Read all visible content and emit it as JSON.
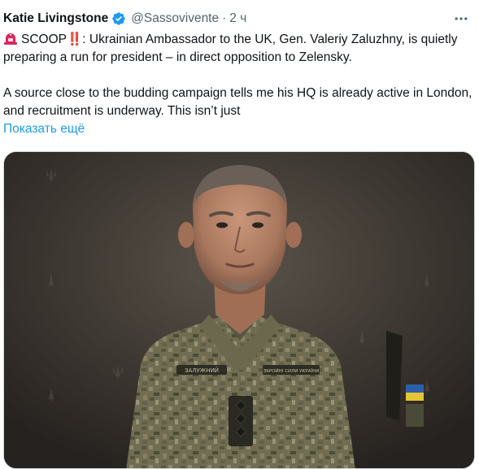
{
  "author": {
    "name": "Katie Livingstone",
    "handle": "@Sassovivente",
    "separator": "·",
    "time": "2 ч"
  },
  "more_icon": "ellipsis-icon",
  "text": {
    "scoop_word": "SCOOP",
    "bangs": "‼️",
    "line1_rest": ": Ukrainian Ambassador to the UK, Gen. Valeriy Zaluzhny, is quietly preparing a run for president – in direct opposition to Zelensky.",
    "paragraph2": "A source close to the budding campaign tells me his HQ is already active in London, and recruitment is underway. This isn’t just"
  },
  "show_more": "Показать ещё",
  "photo": {
    "name_tape": "ЗАЛУЖНИЙ",
    "unit_tape": "ЗБРОЙНІ СИЛИ УКРАЇНИ"
  },
  "colors": {
    "link": "#1d9bf0",
    "verified": "#1d9bf0",
    "siren": "#e0245e",
    "secondary_text": "#536471"
  }
}
